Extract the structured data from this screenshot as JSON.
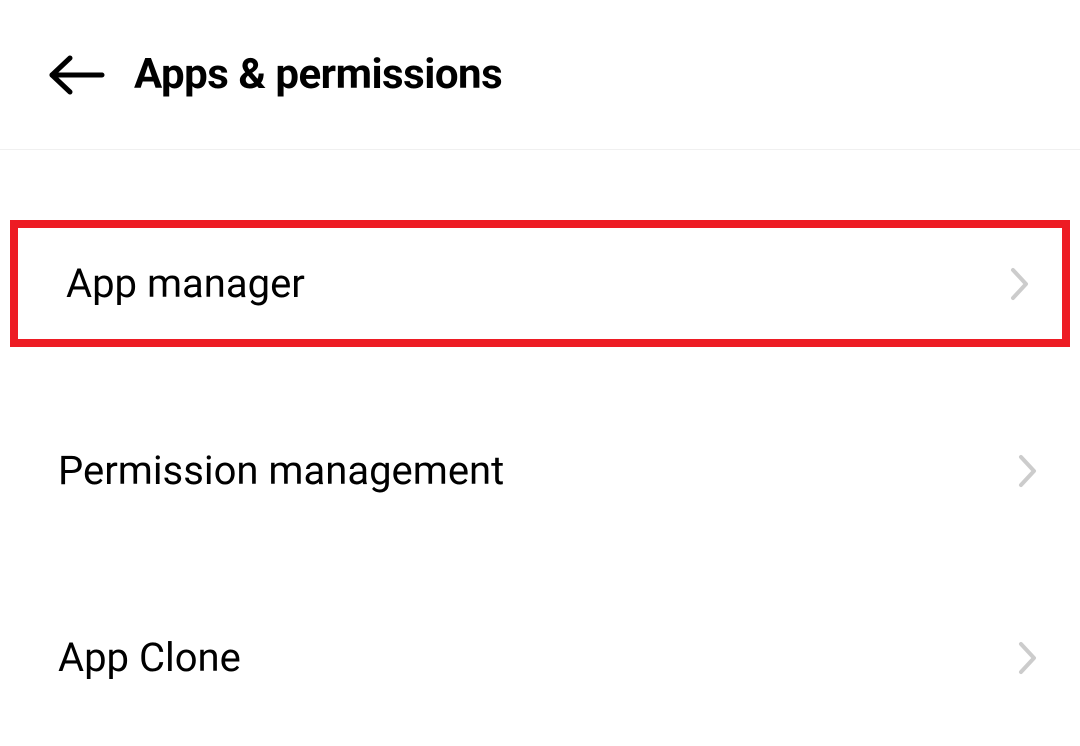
{
  "header": {
    "title": "Apps & permissions"
  },
  "menu": {
    "items": [
      {
        "label": "App manager",
        "highlighted": true
      },
      {
        "label": "Permission management",
        "highlighted": false
      },
      {
        "label": "App Clone",
        "highlighted": false
      }
    ]
  }
}
